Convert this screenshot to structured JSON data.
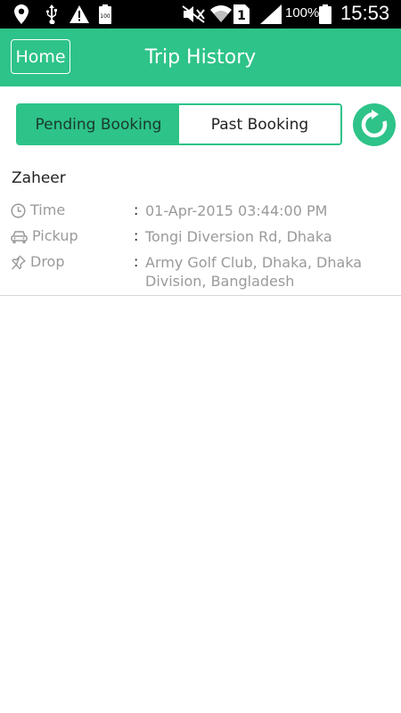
{
  "status_bar": {
    "battery_percent": "100%",
    "time": "15:53",
    "sim_slot": "1",
    "battery_small_label": "100",
    "icons": [
      "location-icon",
      "usb-icon",
      "warning-icon",
      "battery-small-icon",
      "mute-icon",
      "wifi-icon",
      "sim-icon",
      "signal-icon",
      "battery-icon"
    ]
  },
  "header": {
    "home_label": "Home",
    "title": "Trip History",
    "color": "#2ec388"
  },
  "tabs": [
    {
      "label": "Pending Booking",
      "active": true
    },
    {
      "label": "Past Booking",
      "active": false
    }
  ],
  "refresh": {
    "icon": "refresh-icon"
  },
  "bookings": [
    {
      "passenger": "Zaheer",
      "time_label": "Time",
      "time_value": "01-Apr-2015 03:44:00 PM",
      "pickup_label": "Pickup",
      "pickup_value": "Tongi Diversion Rd, Dhaka",
      "drop_label": "Drop",
      "drop_value": "Army Golf Club, Dhaka, Dhaka Division, Bangladesh",
      "separator": ":"
    }
  ]
}
